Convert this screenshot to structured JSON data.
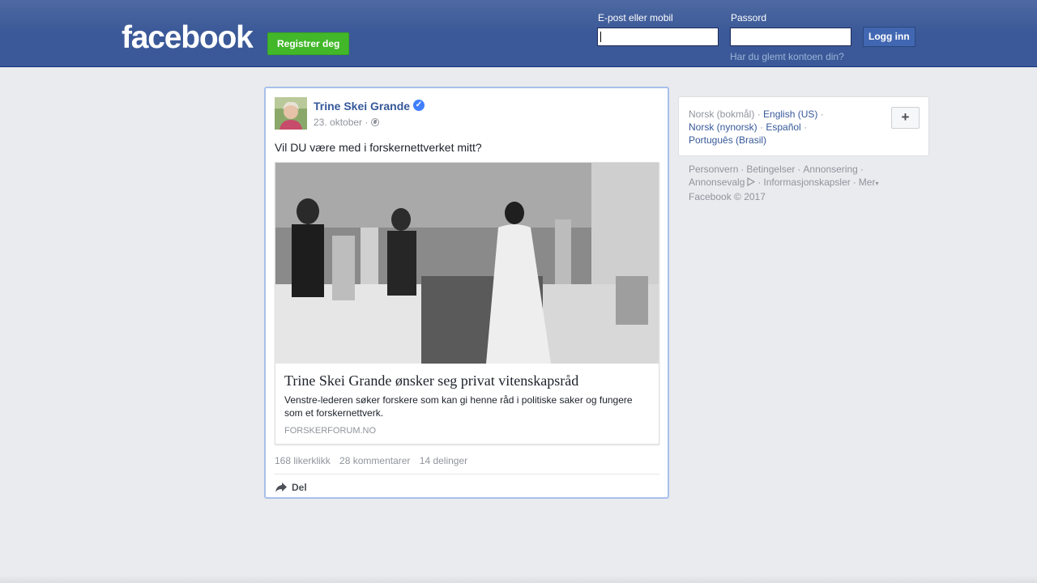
{
  "header": {
    "logo": "facebook",
    "register_label": "Registrer deg",
    "email_label": "E-post eller mobil",
    "email_value": "",
    "password_label": "Passord",
    "password_value": "",
    "login_label": "Logg inn",
    "forgot_label": "Har du glemt kontoen din?"
  },
  "post": {
    "author": "Trine Skei Grande",
    "verified_icon": "verified-badge-icon",
    "date": "23. oktober ·",
    "privacy_icon": "globe-icon",
    "text": "Vil DU være med i forskernettverket mitt?",
    "link": {
      "title": "Trine Skei Grande ønsker seg privat vitenskapsråd",
      "description": "Venstre-lederen søker forskere som kan gi henne råd i politiske saker og fungere som et forskernettverk.",
      "source": "FORSKERFORUM.NO"
    },
    "stats": {
      "likes": "168 likerklikk",
      "comments": "28 kommentarer",
      "shares": "14 delinger"
    },
    "share_label": "Del"
  },
  "sidebar": {
    "languages": {
      "current": "Norsk (bokmål)",
      "options": [
        "English (US)",
        "Norsk (nynorsk)",
        "Español",
        "Português (Brasil)"
      ],
      "add_label": "+"
    },
    "footer": {
      "links": [
        "Personvern",
        "Betingelser",
        "Annonsering",
        "Annonsevalg",
        "Informasjonskapsler",
        "Mer"
      ],
      "copyright": "Facebook © 2017"
    }
  },
  "colors": {
    "header_blue": "#3b5998",
    "link_blue": "#365899",
    "register_green": "#42b72a",
    "background": "#e9ebee"
  }
}
